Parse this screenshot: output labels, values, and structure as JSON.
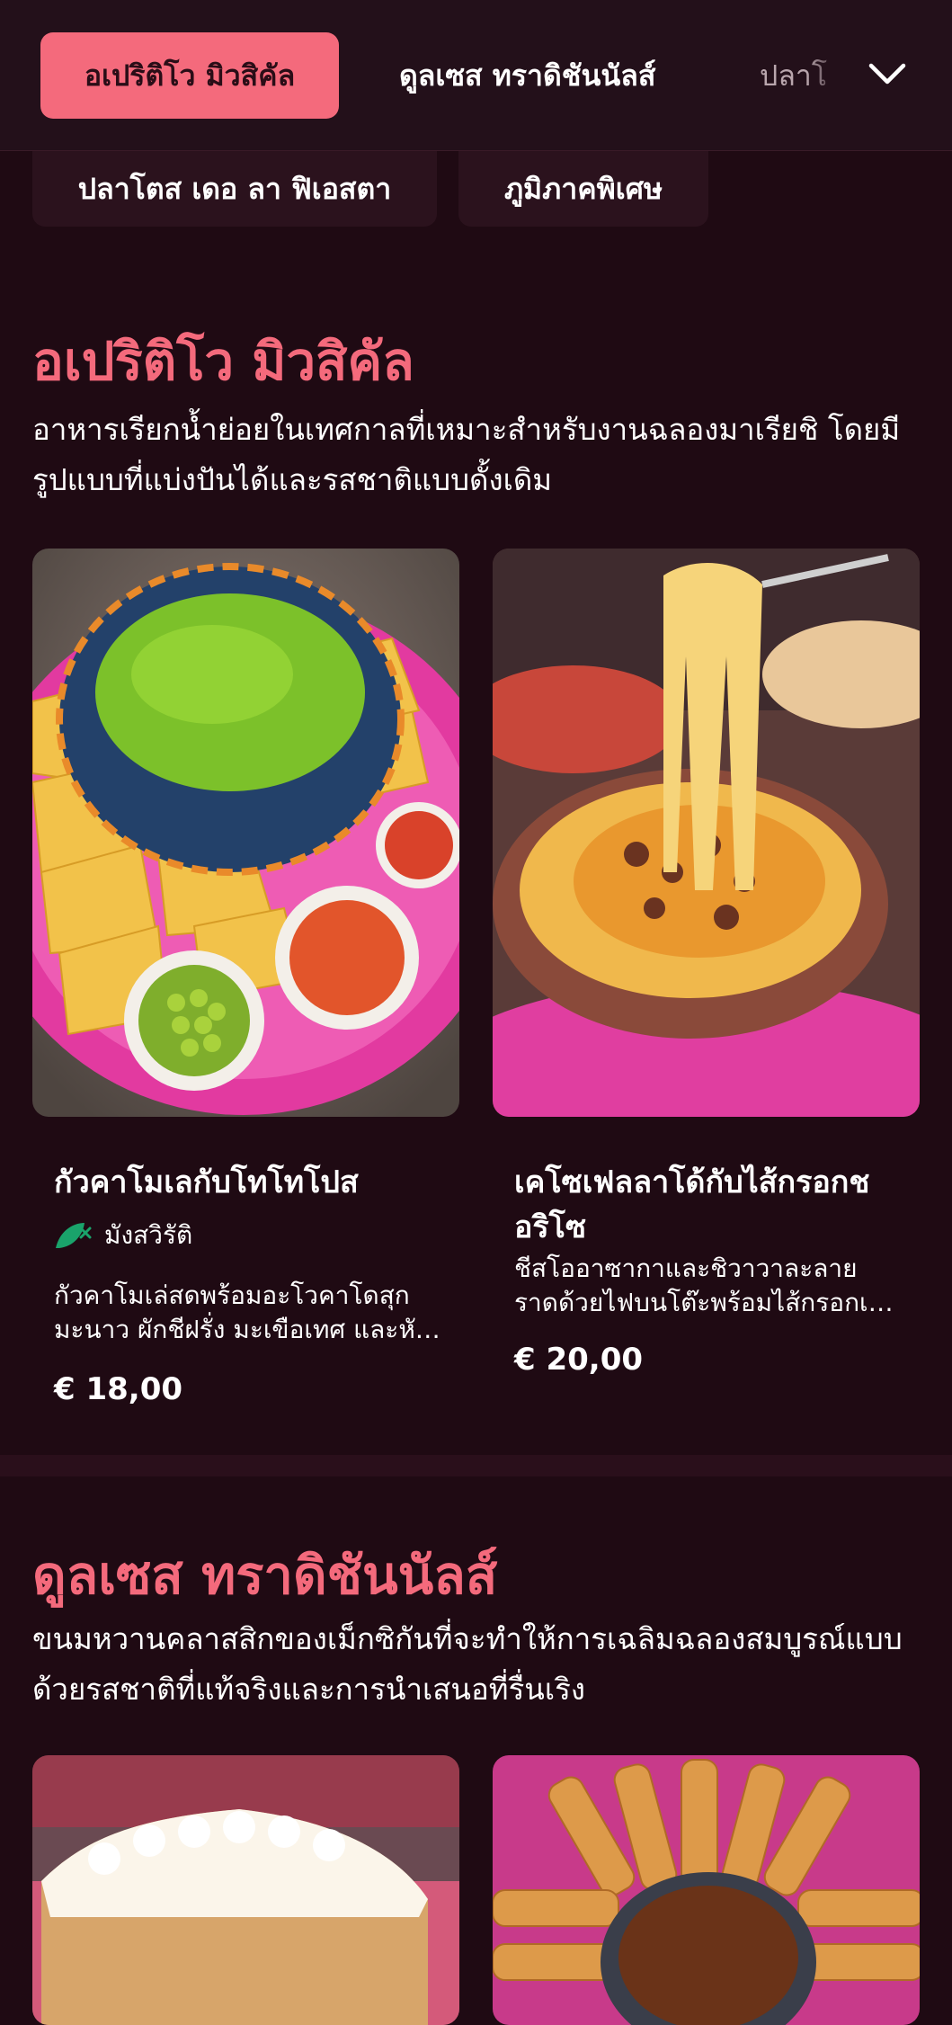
{
  "nav": {
    "tabs": [
      {
        "label": "อเปริติโว มิวสิคัล"
      },
      {
        "label": "ดูลเซส ทราดิชันนัลส์"
      },
      {
        "label": "ปลาโ"
      }
    ],
    "more_icon": "chevron-down-icon",
    "chips": [
      {
        "label": "ปลาโตส เดอ ลา ฟิเอสตา"
      },
      {
        "label": "ภูมิภาคพิเศษ"
      }
    ]
  },
  "sections": [
    {
      "title": "อเปริติโว มิวสิคัล",
      "description": "อาหารเรียกน้ำย่อยในเทศกาลที่เหมาะสำหรับงานฉลองมาเรียชิ โดยมีรูปแบบที่แบ่งปันได้และรสชาติแบบดั้งเดิม",
      "items": [
        {
          "title": "กัวคาโมเลกับโทโทโปส",
          "badge": "มังสวิรัติ",
          "description": "กัวคาโมเล่สดพร้อมอะโวคาโดสุก มะนาว ผักชีฝรั่ง มะเขือเทศ และหัวหอม",
          "price": "€ 18,00"
        },
        {
          "title": "เคโซเฟลลาโด้กับไส้กรอกชอริโซ",
          "description": "ชีสโออาซากาและชิวาวาละลายราดด้วยไฟบนโต๊ะพร้อมไส้กรอกเม็กซิกัน",
          "price": "€ 20,00"
        }
      ]
    },
    {
      "title": "ดูลเซส ทราดิชันนัลส์",
      "description": "ขนมหวานคลาสสิกของเม็กซิกันที่จะทำให้การเฉลิมฉลองสมบูรณ์แบบด้วยรสชาติที่แท้จริงและการนำเสนอที่รื่นเริง"
    }
  ],
  "colors": {
    "background": "#1f0a13",
    "accent": "#f46a7c",
    "veg_icon": "#1aa36b"
  }
}
